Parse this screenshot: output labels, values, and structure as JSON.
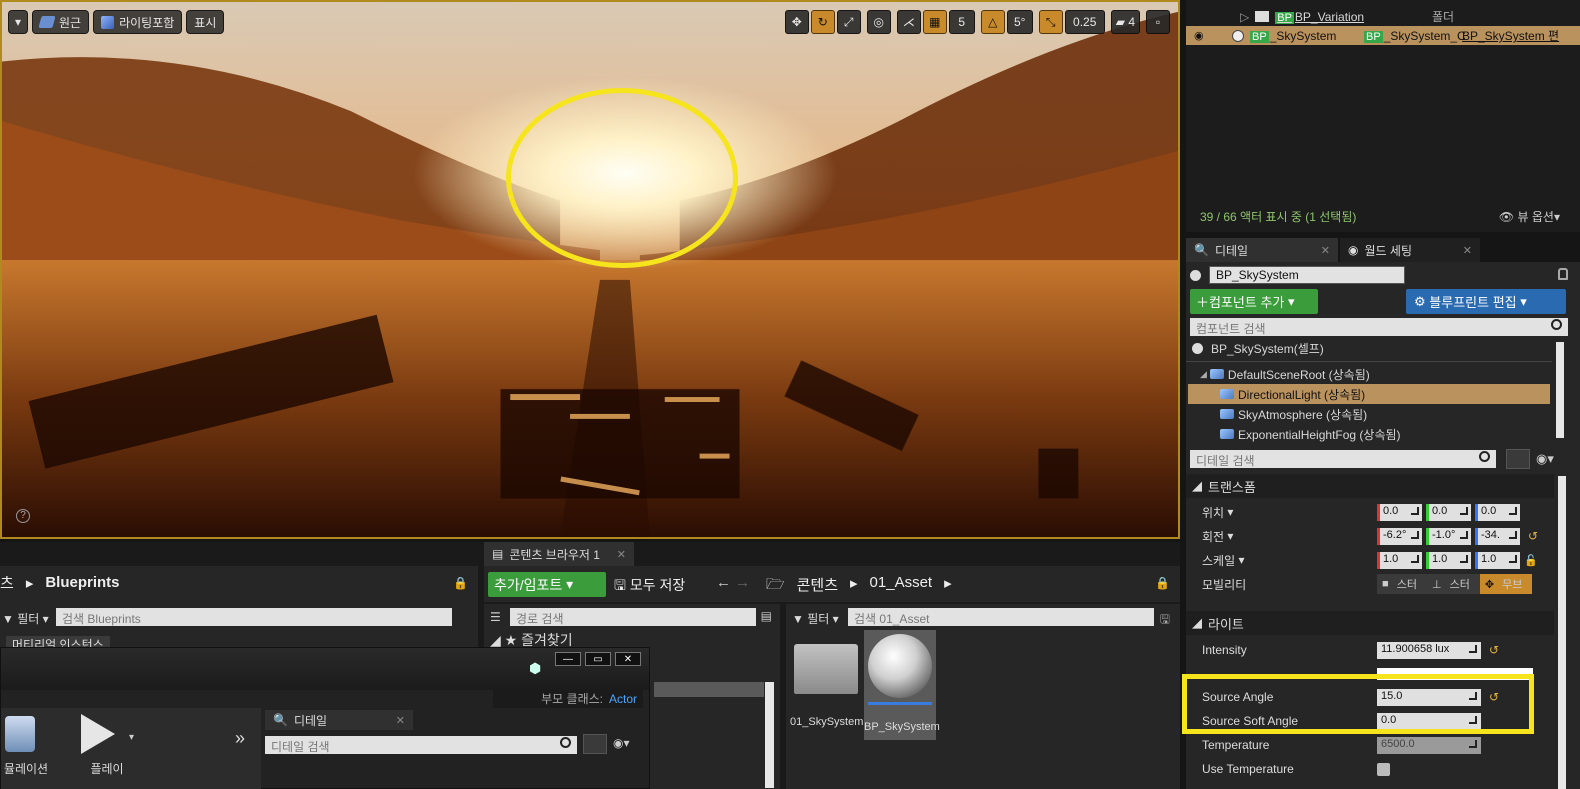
{
  "viewport": {
    "perspective_label": "원근",
    "lighting_label": "라이팅포함",
    "show_label": "표시",
    "grid_snap_value": "5",
    "rotation_snap_value": "5°",
    "scale_snap_value": "0.25",
    "camera_speed_value": "4"
  },
  "outliner": {
    "folder_item": "BP_Variation",
    "folder_type": "폴더",
    "selected_tag1": "BP",
    "selected_name": "_SkySystem",
    "selected_tag2": "BP",
    "selected_class": "_SkySystem_C",
    "selected_edit": "BP_SkySystem 편",
    "status": "39 / 66 액터 표시 중 (1 선택됨)",
    "view_options": "뷰 옵션"
  },
  "details": {
    "tab_details": "디테일",
    "tab_world_settings": "월드 세팅",
    "actor_name": "BP_SkySystem",
    "add_component": "컴포넌트 추가",
    "edit_blueprint": "블루프린트 편집",
    "component_search_placeholder": "컴포넌트 검색",
    "root_component": "BP_SkySystem(셀프)",
    "components": [
      "DefaultSceneRoot (상속됨)",
      "DirectionalLight (상속됨)",
      "SkyAtmosphere (상속됨)",
      "ExponentialHeightFog (상속됨)"
    ],
    "details_search_placeholder": "디테일 검색",
    "transform": {
      "category": "트랜스폼",
      "location_label": "위치",
      "location": [
        "0.0",
        "0.0",
        "0.0"
      ],
      "rotation_label": "회전",
      "rotation": [
        "-6.2°",
        "-1.0°",
        "-34."
      ],
      "scale_label": "스케일",
      "scale": [
        "1.0",
        "1.0",
        "1.0"
      ],
      "mobility_label": "모빌리티",
      "mobility_options": [
        "스터",
        "스터",
        "무브"
      ]
    },
    "light": {
      "category": "라이트",
      "intensity_label": "Intensity",
      "intensity_value": "11.900658 lux",
      "source_angle_label": "Source Angle",
      "source_angle_value": "15.0",
      "source_soft_angle_label": "Source Soft Angle",
      "source_soft_angle_value": "0.0",
      "temperature_label": "Temperature",
      "temperature_value": "6500.0",
      "use_temperature_label": "Use Temperature"
    }
  },
  "left_panel": {
    "crumb_prev": "츠",
    "crumb_current": "Blueprints",
    "filter_label": "필터",
    "search_placeholder": "검색 Blueprints",
    "category_tag": "머티리얼 인스턴스"
  },
  "content_browser": {
    "tab_label": "콘텐츠 브라우저 1",
    "add_import": "추가/임포트",
    "save_all": "모두 저장",
    "path_root": "콘텐츠",
    "path_folder": "01_Asset",
    "path_search_placeholder": "경로 검색",
    "favorites_label": "즐겨찾기",
    "filter_label": "필터",
    "asset_search_placeholder": "검색 01_Asset",
    "assets": [
      "01_SkySystem",
      "BP_SkySystem"
    ]
  },
  "blueprint_window": {
    "parent_class_label": "부모 클래스:",
    "parent_class_value": "Actor",
    "simulation_label": "뮬레이션",
    "play_label": "플레이",
    "details_tab": "디테일",
    "details_search_placeholder": "디테일 검색"
  }
}
